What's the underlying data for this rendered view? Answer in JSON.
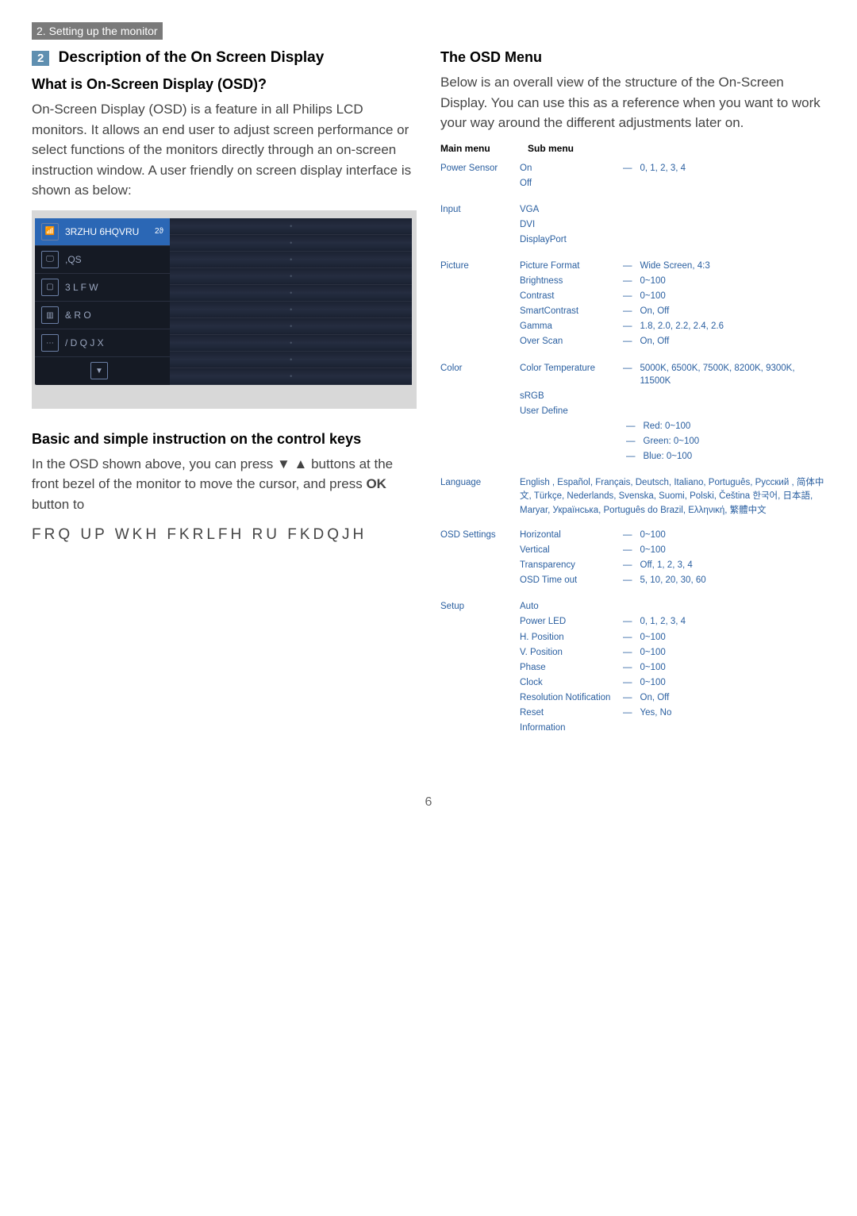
{
  "header": {
    "section_label": "2. Setting up the monitor"
  },
  "left": {
    "badge": "2",
    "title": "Description of the On Screen Display",
    "q_heading": "What is On-Screen Display (OSD)?",
    "p1": "On-Screen Display (OSD) is a feature in all Philips LCD monitors. It allows an end user to adjust screen performance or select functions of the monitors directly through an on-screen instruction window. A user friendly on screen display interface is shown as below:",
    "osd": {
      "items": [
        {
          "icon": "📶",
          "label": "3RZHU 6HQVRU",
          "highlight": true,
          "extra": "2ϑ"
        },
        {
          "icon": "🖵",
          "label": ",QS"
        },
        {
          "icon": "▢",
          "label": "3 L F W"
        },
        {
          "icon": "▥",
          "label": "& R O"
        },
        {
          "icon": "⋯",
          "label": "/ D Q J X"
        },
        {
          "icon": "▼",
          "label": ""
        }
      ]
    },
    "sub_heading": "Basic and simple instruction on the control keys",
    "p2_a": "In the OSD shown above, you can press ▼ ▲ buttons at the front bezel of the monitor to move the cursor, and press ",
    "p2_ok": "OK",
    "p2_b": " button to",
    "p3_scrambled": "FRQ UP WKH FKRLFH RU FKDQJH"
  },
  "right": {
    "title": "The OSD Menu",
    "intro": "Below is an overall view of the structure of the On-Screen Display. You can use this as a reference when you want to work your way around the different adjustments later on.",
    "headings": {
      "main": "Main menu",
      "sub": "Sub menu"
    },
    "menu": [
      {
        "name": "Power Sensor",
        "items": [
          {
            "label": "On",
            "val": "0, 1, 2, 3, 4"
          },
          {
            "label": "Off",
            "val": ""
          }
        ]
      },
      {
        "name": "Input",
        "items": [
          {
            "label": "VGA",
            "val": ""
          },
          {
            "label": "DVI",
            "val": ""
          },
          {
            "label": "DisplayPort",
            "val": ""
          }
        ]
      },
      {
        "name": "Picture",
        "items": [
          {
            "label": "Picture Format",
            "val": "Wide Screen, 4:3"
          },
          {
            "label": "Brightness",
            "val": "0~100"
          },
          {
            "label": "Contrast",
            "val": "0~100"
          },
          {
            "label": "SmartContrast",
            "val": "On, Off"
          },
          {
            "label": "Gamma",
            "val": "1.8, 2.0, 2.2, 2.4, 2.6"
          },
          {
            "label": "Over Scan",
            "val": "On, Off"
          }
        ]
      },
      {
        "name": "Color",
        "items": [
          {
            "label": "Color Temperature",
            "val": "5000K, 6500K, 7500K, 8200K, 9300K, 11500K"
          },
          {
            "label": "sRGB",
            "val": ""
          },
          {
            "label": "User Define",
            "val": "",
            "children": [
              "Red: 0~100",
              "Green: 0~100",
              "Blue: 0~100"
            ]
          }
        ]
      },
      {
        "name": "Language",
        "langs": "English , Español, Français, Deutsch, Italiano, Português, Русский , 简体中文, Türkçe, Nederlands, Svenska, Suomi, Polski, Čeština 한국어, 日本語, Maryar, Українська, Português do Brazil, Ελληνική, 繁體中文"
      },
      {
        "name": "OSD Settings",
        "items": [
          {
            "label": "Horizontal",
            "val": "0~100"
          },
          {
            "label": "Vertical",
            "val": "0~100"
          },
          {
            "label": "Transparency",
            "val": "Off, 1, 2, 3, 4"
          },
          {
            "label": "OSD Time out",
            "val": "5, 10, 20, 30, 60"
          }
        ]
      },
      {
        "name": "Setup",
        "items": [
          {
            "label": "Auto",
            "val": ""
          },
          {
            "label": "Power LED",
            "val": "0, 1, 2, 3, 4"
          },
          {
            "label": "H. Position",
            "val": "0~100"
          },
          {
            "label": "V. Position",
            "val": "0~100"
          },
          {
            "label": "Phase",
            "val": "0~100"
          },
          {
            "label": "Clock",
            "val": "0~100"
          },
          {
            "label": "Resolution Notification",
            "val": "On, Off"
          },
          {
            "label": "Reset",
            "val": "Yes, No"
          },
          {
            "label": "Information",
            "val": ""
          }
        ]
      }
    ]
  },
  "page_number": "6"
}
